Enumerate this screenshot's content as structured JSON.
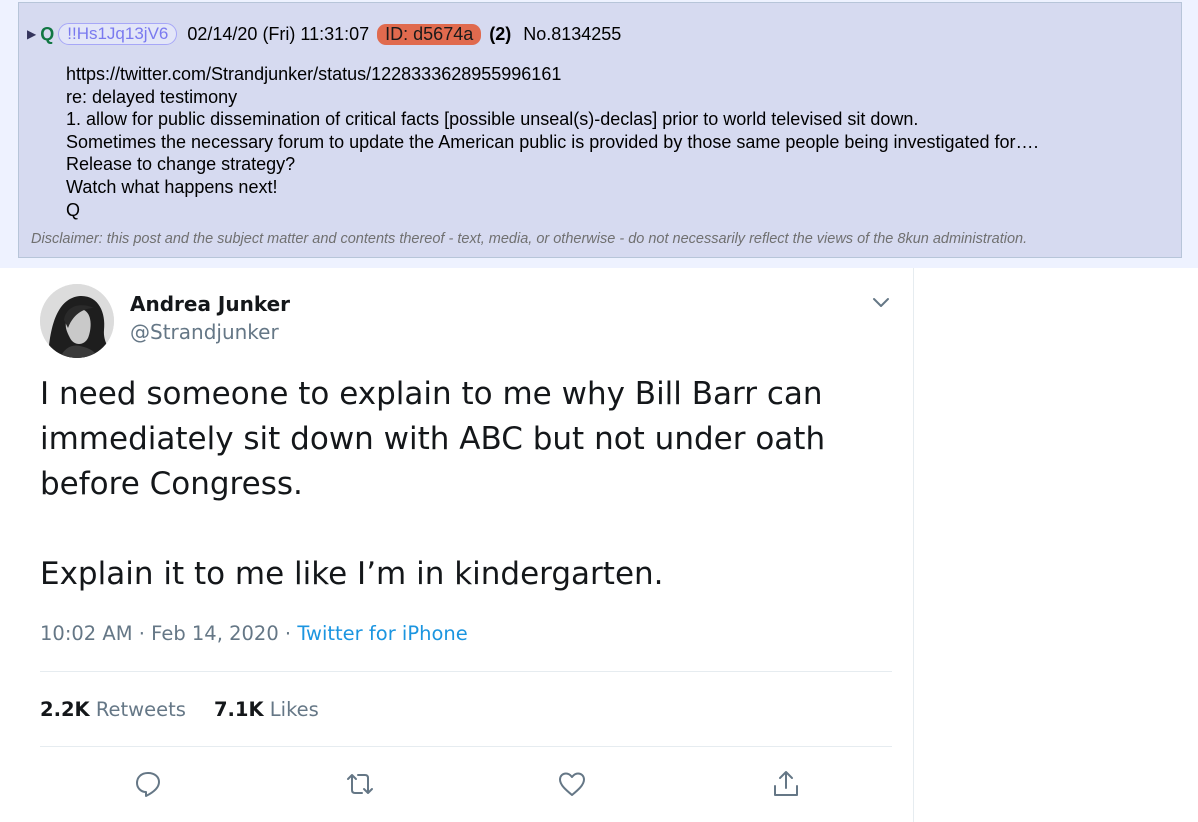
{
  "post": {
    "arrow": "▶",
    "name": "Q",
    "tripcode": "!!Hs1Jq13jV6",
    "date": "02/14/20 (Fri) 11:31:07",
    "poster_id": "ID: d5674a",
    "reply_count": "(2)",
    "post_number": "No.8134255",
    "body_lines": [
      "https://twitter.com/Strandjunker/status/1228333628955996161",
      "re: delayed testimony",
      "1. allow for public dissemination of critical facts [possible unseal(s)-declas] prior to world televised sit down.",
      "Sometimes the necessary forum to update the American public is provided by those same people being investigated for….",
      "Release to change strategy?",
      "Watch what happens next!",
      "Q"
    ],
    "disclaimer": "Disclaimer: this post and the subject matter and contents thereof - text, media, or otherwise - do not necessarily reflect the views of the 8kun administration."
  },
  "tweet": {
    "display_name": "Andrea Junker",
    "handle": "@Strandjunker",
    "text_paragraph_1_lines": [
      "I need someone to explain to me why Bill Barr can",
      "immediately sit down with ABC but not under oath",
      "before Congress."
    ],
    "text_paragraph_2": "Explain it to me like I’m in kindergarten.",
    "time": "10:02 AM",
    "separator": " · ",
    "date": "Feb 14, 2020",
    "source": "Twitter for iPhone",
    "retweets_count": "2.2K",
    "retweets_label": "Retweets",
    "likes_count": "7.1K",
    "likes_label": "Likes",
    "colors": {
      "link_blue": "#1b95e0",
      "secondary_text": "#657786",
      "primary_text": "#14171a"
    },
    "icons": [
      "chevron-down-icon",
      "reply-icon",
      "retweet-icon",
      "like-icon",
      "share-icon"
    ]
  }
}
